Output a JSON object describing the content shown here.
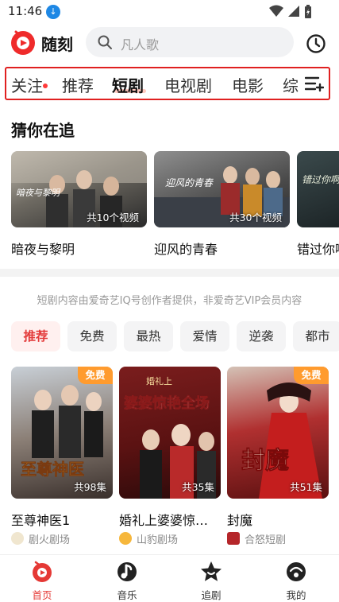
{
  "status": {
    "time": "11:46",
    "download_badge": "↓"
  },
  "header": {
    "app_name": "随刻",
    "search_placeholder": "凡人歌"
  },
  "tabs": [
    {
      "label": "关注"
    },
    {
      "label": "推荐"
    },
    {
      "label": "短剧"
    },
    {
      "label": "电视剧"
    },
    {
      "label": "电影"
    },
    {
      "label": "综"
    }
  ],
  "following": {
    "title": "猜你在追",
    "items": [
      {
        "title": "暗夜与黎明",
        "count": "共10个视频",
        "art_text": "暗夜与黎明"
      },
      {
        "title": "迎风的青春",
        "count": "共30个视频",
        "art_text": "迎风的青春"
      },
      {
        "title": "错过你啊",
        "count": "",
        "art_text": "错过你啊"
      }
    ]
  },
  "notice": "短剧内容由爱奇艺IQ号创作者提供，非爱奇艺VIP会员内容",
  "chips": [
    "推荐",
    "免费",
    "最热",
    "爱情",
    "逆袭",
    "都市"
  ],
  "dramas": [
    {
      "title": "至尊神医1",
      "episodes": "共98集",
      "badge": "免费",
      "source": "剧火剧场",
      "art_text": "至尊神医"
    },
    {
      "title": "婚礼上婆婆惊…",
      "episodes": "共35集",
      "badge": "",
      "source": "山豹剧场",
      "art_text": "婆婆惊艳全场",
      "art_top": "婚礼上"
    },
    {
      "title": "封魔",
      "episodes": "共51集",
      "badge": "免费",
      "source": "合怒短剧",
      "art_text": "封魔"
    }
  ],
  "bottom_nav": [
    {
      "label": "首页"
    },
    {
      "label": "音乐"
    },
    {
      "label": "追剧"
    },
    {
      "label": "我的"
    }
  ],
  "colors": {
    "accent": "#e53935",
    "tab_border": "#e02020",
    "free_badge": "#ff9b2e"
  }
}
